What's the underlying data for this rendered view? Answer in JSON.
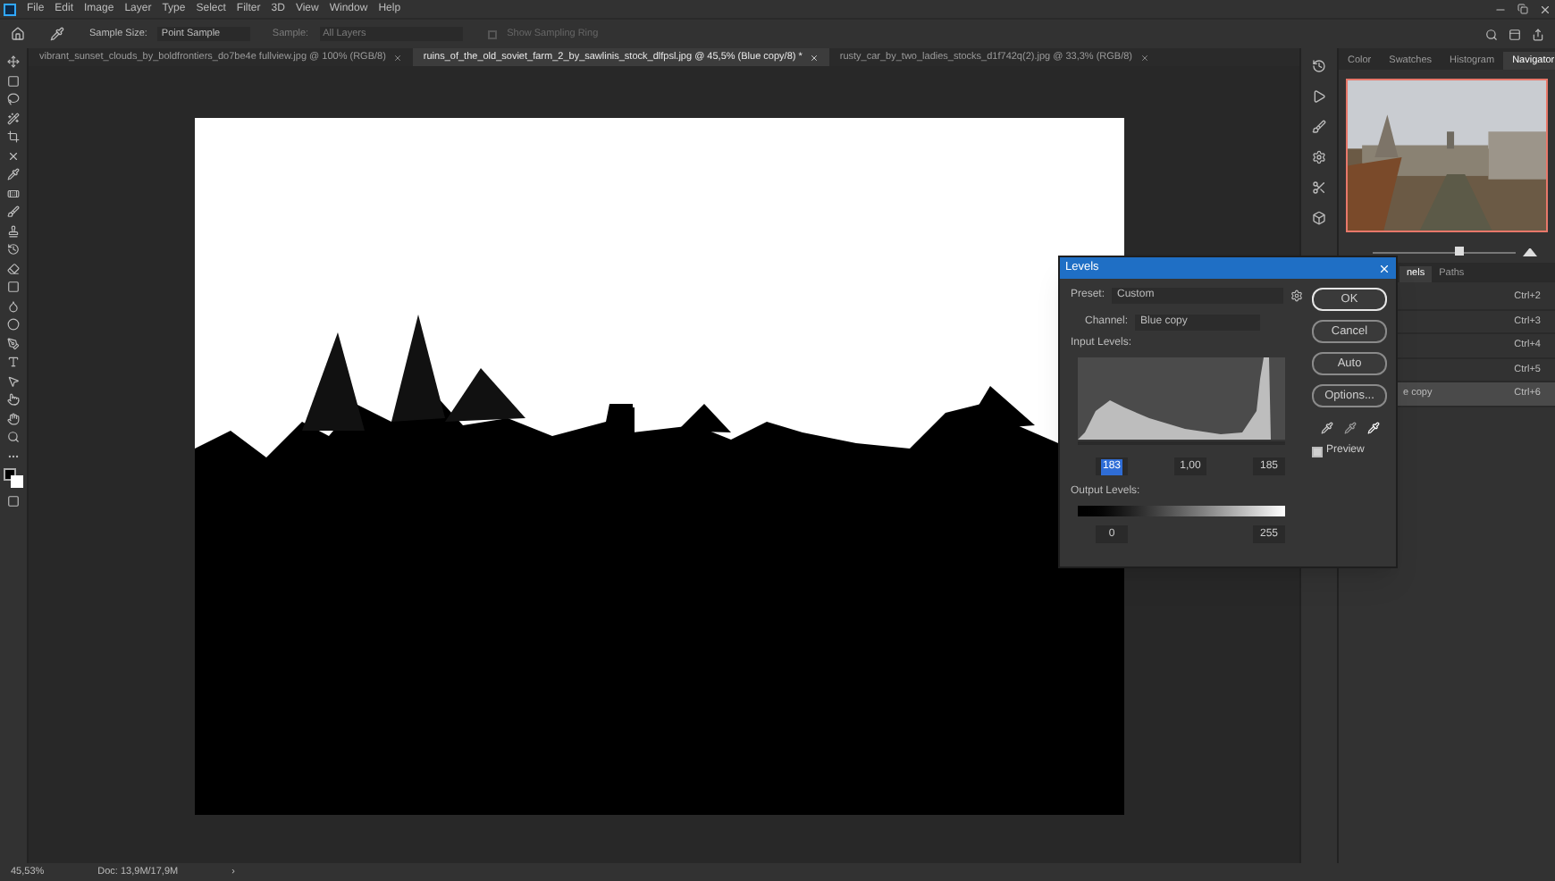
{
  "menu": [
    "File",
    "Edit",
    "Image",
    "Layer",
    "Type",
    "Select",
    "Filter",
    "3D",
    "View",
    "Window",
    "Help"
  ],
  "options_bar": {
    "sample_size_label": "Sample Size:",
    "sample_size": "Point Sample",
    "sample_label": "Sample:",
    "sample": "All Layers",
    "show_sampling_ring": {
      "label": "Show Sampling Ring",
      "checked": false,
      "disabled": true
    }
  },
  "document_tabs": [
    {
      "title": "vibrant_sunset_clouds_by_boldfrontiers_do7be4e fullview.jpg @ 100% (RGB/8)",
      "selected": false
    },
    {
      "title": "ruins_of_the_old_soviet_farm_2_by_sawlinis_stock_dlfpsl.jpg @ 45,5% (Blue copy/8) *",
      "selected": true
    },
    {
      "title": "rusty_car_by_two_ladies_stocks_d1f742q(2).jpg @ 33,3% (RGB/8)",
      "selected": false
    }
  ],
  "panel_tabs": [
    {
      "label": "Color",
      "selected": false
    },
    {
      "label": "Swatches",
      "selected": false
    },
    {
      "label": "Histogram",
      "selected": false
    },
    {
      "label": "Navigator",
      "selected": true
    }
  ],
  "navigator": {
    "zoom_slider": {
      "level": 0.6
    }
  },
  "channels": {
    "tabs": [
      {
        "label": "nels",
        "selected": true
      },
      {
        "label": "Paths",
        "selected": false
      }
    ],
    "rows": [
      {
        "shortcut": "Ctrl+2",
        "selected": false
      },
      {
        "shortcut": "Ctrl+3",
        "selected": false
      },
      {
        "shortcut": "Ctrl+4",
        "selected": false
      },
      {
        "shortcut": "Ctrl+5",
        "selected": false
      },
      {
        "label": "e copy",
        "shortcut": "Ctrl+6",
        "selected": true
      }
    ]
  },
  "levels_dialog": {
    "title": "Levels",
    "preset_label": "Preset:",
    "preset": "Custom",
    "channel_label": "Channel:",
    "channel": "Blue copy",
    "input_levels_label": "Input Levels:",
    "input_levels": [
      {
        "value": "183",
        "selected": true
      },
      {
        "value": "1,00",
        "selected": false
      },
      {
        "value": "185",
        "selected": false
      }
    ],
    "output_levels_label": "Output Levels:",
    "output_levels": [
      "0",
      "255"
    ],
    "buttons": [
      {
        "label": "OK",
        "default": true
      },
      {
        "label": "Cancel",
        "default": false
      },
      {
        "label": "Auto",
        "default": false
      },
      {
        "label": "Options...",
        "default": false
      }
    ],
    "preview": {
      "label": "Preview",
      "checked": true
    }
  },
  "status_bar": {
    "zoom": "45,53%",
    "doc": "Doc: 13,9M/17,9M",
    "arrow": "›"
  }
}
